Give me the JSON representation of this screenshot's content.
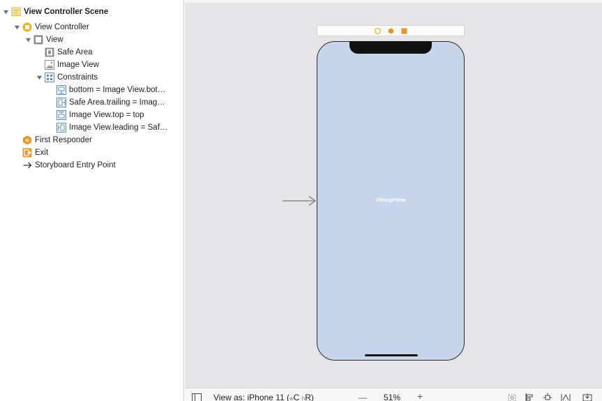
{
  "outline": {
    "scene": "View Controller Scene",
    "view_controller": "View Controller",
    "view": "View",
    "safe_area": "Safe Area",
    "image_view": "Image View",
    "constraints": "Constraints",
    "constraint_items": [
      "bottom = Image View.bot…",
      "Safe Area.trailing = Imag…",
      "Image View.top = top",
      "Image View.leading = Saf…"
    ],
    "first_responder": "First Responder",
    "exit": "Exit",
    "entry_point": "Storyboard Entry Point"
  },
  "canvas": {
    "image_view_placeholder": "UIImageView"
  },
  "bottom_bar": {
    "view_as": "View as: iPhone 11 (",
    "size_class_w": "w",
    "size_class_C": "C",
    "size_class_h": "h",
    "size_class_R": "R)",
    "zoom_out": "—",
    "zoom_level": "51%",
    "zoom_in": "+"
  },
  "colors": {
    "vc_yellow": "#f2b21c",
    "canvas_bg": "#e5e5e7",
    "phone_bg": "#c6d5e9"
  },
  "icons": [
    "scene-icon",
    "view-controller-icon",
    "view-icon",
    "safe-area-icon",
    "image-view-icon",
    "constraints-icon",
    "constraint-icon",
    "first-responder-icon",
    "exit-icon",
    "entry-arrow-icon"
  ]
}
